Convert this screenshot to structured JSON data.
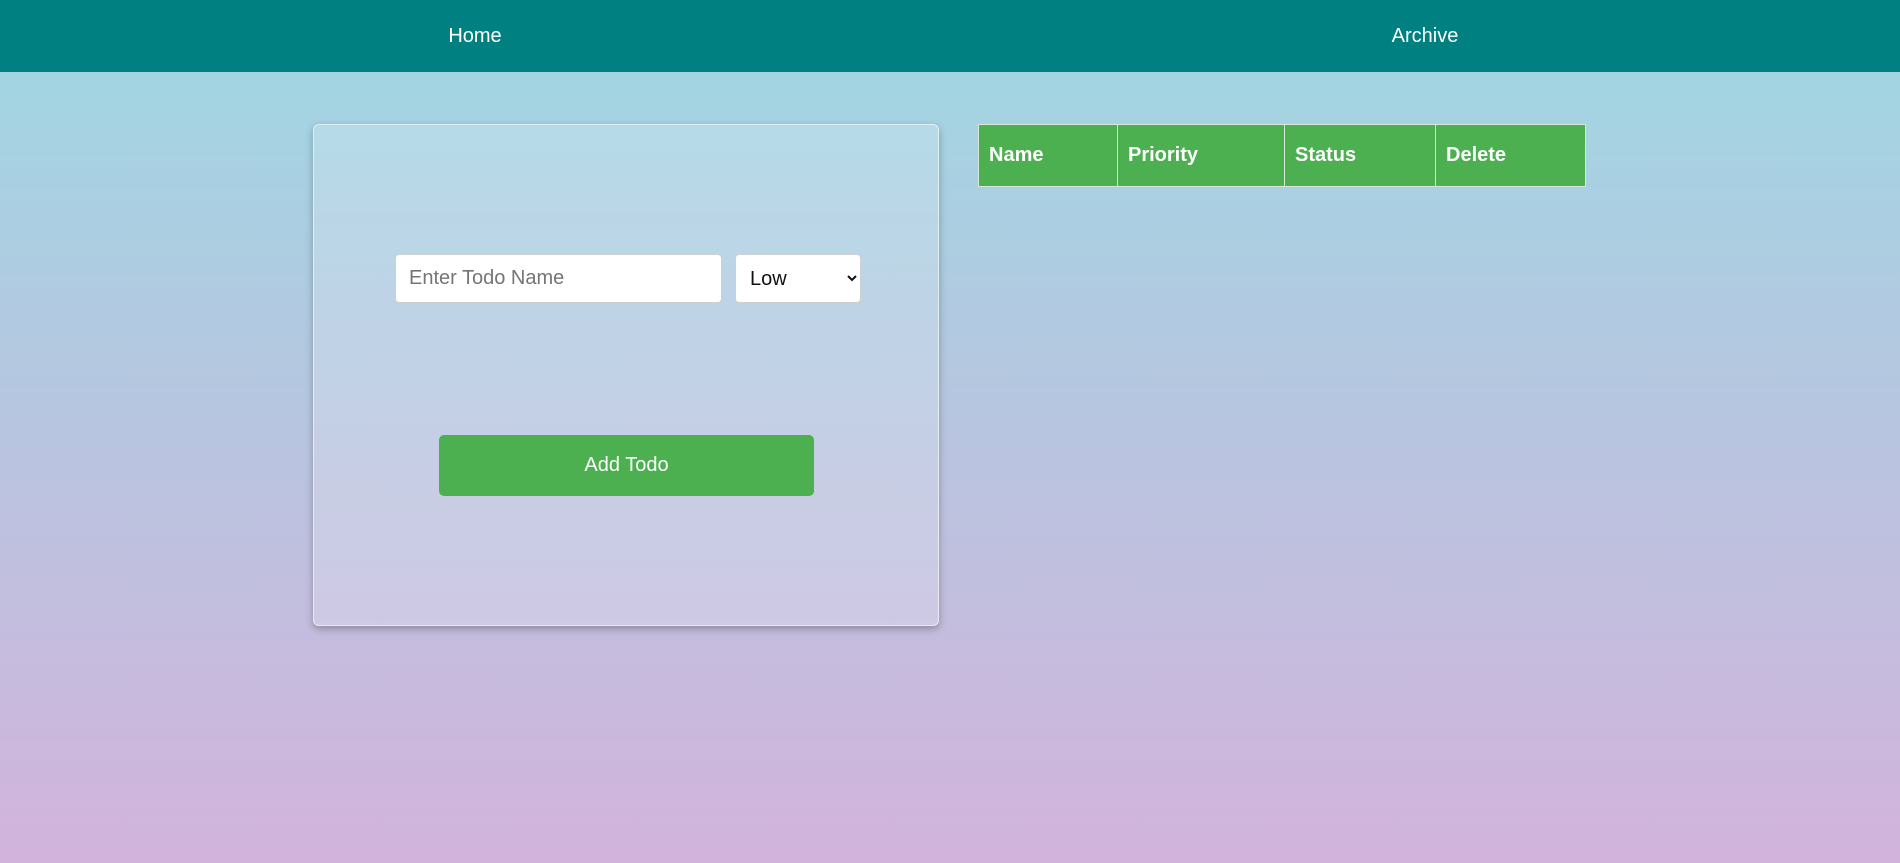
{
  "nav": {
    "home_label": "Home",
    "archive_label": "Archive"
  },
  "form": {
    "name_placeholder": "Enter Todo Name",
    "priority_selected": "Low",
    "add_label": "Add Todo"
  },
  "table": {
    "headers": [
      "Name",
      "Priority",
      "Status",
      "Delete"
    ]
  },
  "colors": {
    "navbar": "#008080",
    "accent_green": "#4caf50",
    "gradient_top": "#9ed8e3",
    "gradient_bottom": "#d2b3db"
  }
}
